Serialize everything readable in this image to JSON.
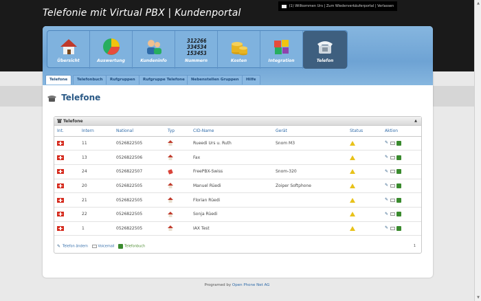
{
  "header": {
    "title": "Telefonie mit Virtual PBX | Kundenportal"
  },
  "userbar": {
    "count": "(1)",
    "welcome": "Willkommen Urs",
    "separator1": "|",
    "reseller": "Zum Wiederverkäuferportal",
    "separator2": "|",
    "logout": "Verlassen"
  },
  "nav": {
    "items": [
      {
        "label": "Übersicht",
        "icon": "house-icon"
      },
      {
        "label": "Auswertung",
        "icon": "pie-chart-icon"
      },
      {
        "label": "Kundeninfo",
        "icon": "users-icon"
      },
      {
        "label": "Nummern",
        "icon": "numbers-icon",
        "digits": [
          "3122665",
          "3345345",
          "1534534"
        ]
      },
      {
        "label": "Kosten",
        "icon": "coins-icon"
      },
      {
        "label": "Integration",
        "icon": "puzzle-icon"
      },
      {
        "label": "Telefon",
        "icon": "phone-icon",
        "active": true
      }
    ]
  },
  "subtabs": [
    "Telefone",
    "Telefonbuch",
    "Rufgruppen",
    "Rufgruppe Telefone",
    "Nebenstellen Gruppen",
    "Hilfe"
  ],
  "page": {
    "title": "Telefone"
  },
  "box": {
    "title": "Telefone",
    "collapse": "▲"
  },
  "table": {
    "headers": [
      "Int.",
      "Intern",
      "National",
      "Typ",
      "CID-Name",
      "Gerät",
      "Status",
      "Aktion"
    ],
    "rows": [
      {
        "intern": "11",
        "national": "0526822505",
        "cid": "Rueedi Urs u. Ruth",
        "device": "Snom M3",
        "type": "house"
      },
      {
        "intern": "13",
        "national": "0526822506",
        "cid": "Fax",
        "device": "",
        "type": "house"
      },
      {
        "intern": "24",
        "national": "0526822507",
        "cid": "FreePBX-Swiss",
        "device": "Snom-320",
        "type": "external"
      },
      {
        "intern": "20",
        "national": "0526822505",
        "cid": "Manuel Rüedi",
        "device": "Zoiper Softphone",
        "type": "house"
      },
      {
        "intern": "21",
        "national": "0526822505",
        "cid": "Florian Rüedi",
        "device": "",
        "type": "house"
      },
      {
        "intern": "22",
        "national": "0526822505",
        "cid": "Sonja Rüedi",
        "device": "",
        "type": "house"
      },
      {
        "intern": "1",
        "national": "0526822505",
        "cid": "IAX Test",
        "device": "",
        "type": "house"
      }
    ]
  },
  "footer": {
    "edit": "Telefon ändern",
    "voicemail": "Voicemail",
    "phonebook": "Telefonbuch",
    "page": "1"
  },
  "credit": {
    "prefix": "Programed by",
    "company": "Open Phone Net AG"
  },
  "colors": {
    "accent": "#2e6aa8",
    "nav": "#7fb2de",
    "active": "#3e5f7f",
    "warn": "#e8c21a"
  }
}
